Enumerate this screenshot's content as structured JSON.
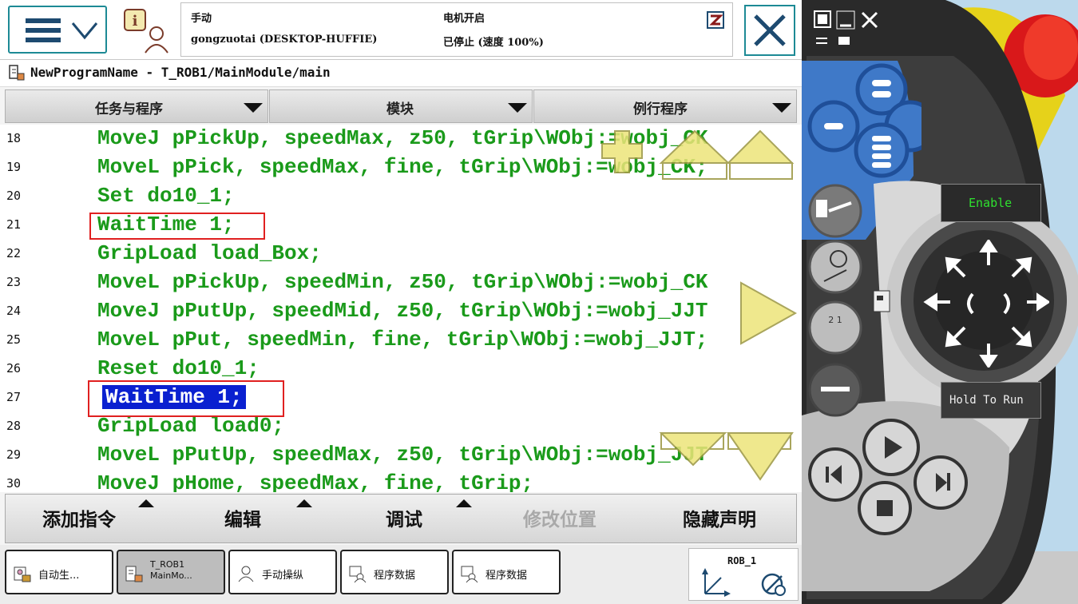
{
  "header": {
    "mode": "手动",
    "motor_status": "电机开启",
    "station": "gongzuotai (DESKTOP-HUFFIE)",
    "run_status": "已停止 (速度 100%)"
  },
  "breadcrumb": "NewProgramName - T_ROB1/MainModule/main",
  "selectors": [
    "任务与程序",
    "模块",
    "例行程序"
  ],
  "code_lines": [
    {
      "n": "18",
      "text": "MoveJ pPickUp, speedMax, z50, tGrip\\WObj:=wobj_CK"
    },
    {
      "n": "19",
      "text": "MoveL pPick, speedMax, fine, tGrip\\WObj:=wobj_CK;"
    },
    {
      "n": "20",
      "text": "Set do10_1;"
    },
    {
      "n": "21",
      "text": "WaitTime 1;"
    },
    {
      "n": "22",
      "text": "GripLoad load_Box;"
    },
    {
      "n": "23",
      "text": "MoveL pPickUp, speedMin, z50, tGrip\\WObj:=wobj_CK"
    },
    {
      "n": "24",
      "text": "MoveJ pPutUp, speedMid, z50, tGrip\\WObj:=wobj_JJT"
    },
    {
      "n": "25",
      "text": "MoveL pPut, speedMin, fine, tGrip\\WObj:=wobj_JJT;"
    },
    {
      "n": "26",
      "text": "Reset do10_1;"
    },
    {
      "n": "27",
      "text": "WaitTime 1;"
    },
    {
      "n": "28",
      "text": "GripLoad load0;"
    },
    {
      "n": "29",
      "text": "MoveL pPutUp, speedMax, z50, tGrip\\WObj:=wobj_JJT"
    },
    {
      "n": "30",
      "text": "MoveJ pHome, speedMax, fine, tGrip;"
    }
  ],
  "selected_line": "27",
  "commands": {
    "add": "添加指令",
    "edit": "编辑",
    "debug": "调试",
    "modify_pos": "修改位置",
    "hide_decl": "隐藏声明"
  },
  "tasks": [
    {
      "label": "自动生...",
      "active": false
    },
    {
      "label": "T_ROB1\nMainMo...",
      "active": true
    },
    {
      "label": "手动操纵",
      "active": false
    },
    {
      "label": "程序数据",
      "active": false
    },
    {
      "label": "程序数据",
      "active": false
    }
  ],
  "rob_label": "ROB_1",
  "pendant": {
    "enable": "Enable",
    "hold_to_run": "Hold To Run"
  },
  "colors": {
    "code_green": "#1a9a1a",
    "selection_blue": "#0a20d0",
    "highlight_red": "#e02020",
    "accent_teal": "#1d8a95",
    "pendant_blue": "#3f79c8"
  }
}
